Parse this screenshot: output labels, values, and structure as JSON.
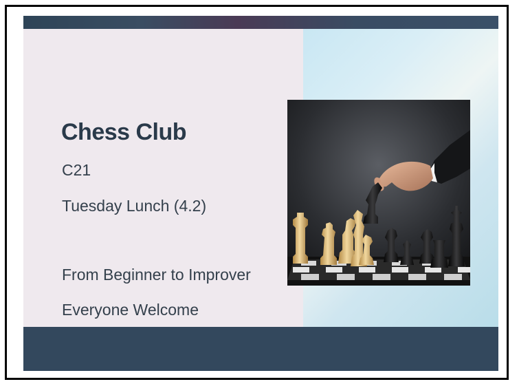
{
  "slide": {
    "title": "Chess Club",
    "room": "C21",
    "schedule": "Tuesday Lunch (4.2)",
    "tagline": "From Beginner to Improver",
    "welcome": "Everyone Welcome"
  },
  "image": {
    "subject": "hand-moving-chess-piece-photo"
  },
  "colors": {
    "title_text": "#2a3a4a",
    "body_text": "#34404c",
    "left_panel": "#efe9ee",
    "dark_band": "#33485d"
  }
}
